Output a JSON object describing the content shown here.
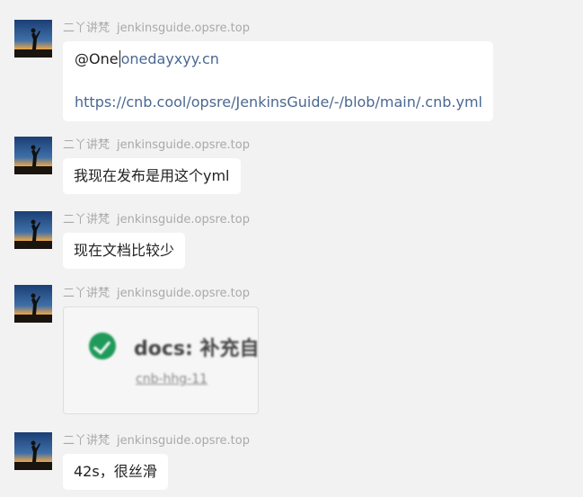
{
  "colors": {
    "background": "#f2f2f2",
    "bubble": "#ffffff",
    "link": "#4a6892",
    "sender": "#a9a9a9",
    "check": "#1f9a5a"
  },
  "messages": [
    {
      "sender_name": "二丫讲梵",
      "sender_site": "jenkinsguide.opsre.top",
      "mention": "@One",
      "mention_link": "onedayxyy.cn",
      "url": "https://cnb.cool/opsre/JenkinsGuide/-/blob/main/.cnb.yml"
    },
    {
      "sender_name": "二丫讲梵",
      "sender_site": "jenkinsguide.opsre.top",
      "text": "我现在发布是用这个yml"
    },
    {
      "sender_name": "二丫讲梵",
      "sender_site": "jenkinsguide.opsre.top",
      "text": "现在文档比较少"
    },
    {
      "sender_name": "二丫讲梵",
      "sender_site": "jenkinsguide.opsre.top",
      "card_title": "docs: 补充自",
      "card_sub": "cnb-hhg-11",
      "card_icon": "check-circle-icon"
    },
    {
      "sender_name": "二丫讲梵",
      "sender_site": "jenkinsguide.opsre.top",
      "text": "42s，很丝滑"
    }
  ]
}
